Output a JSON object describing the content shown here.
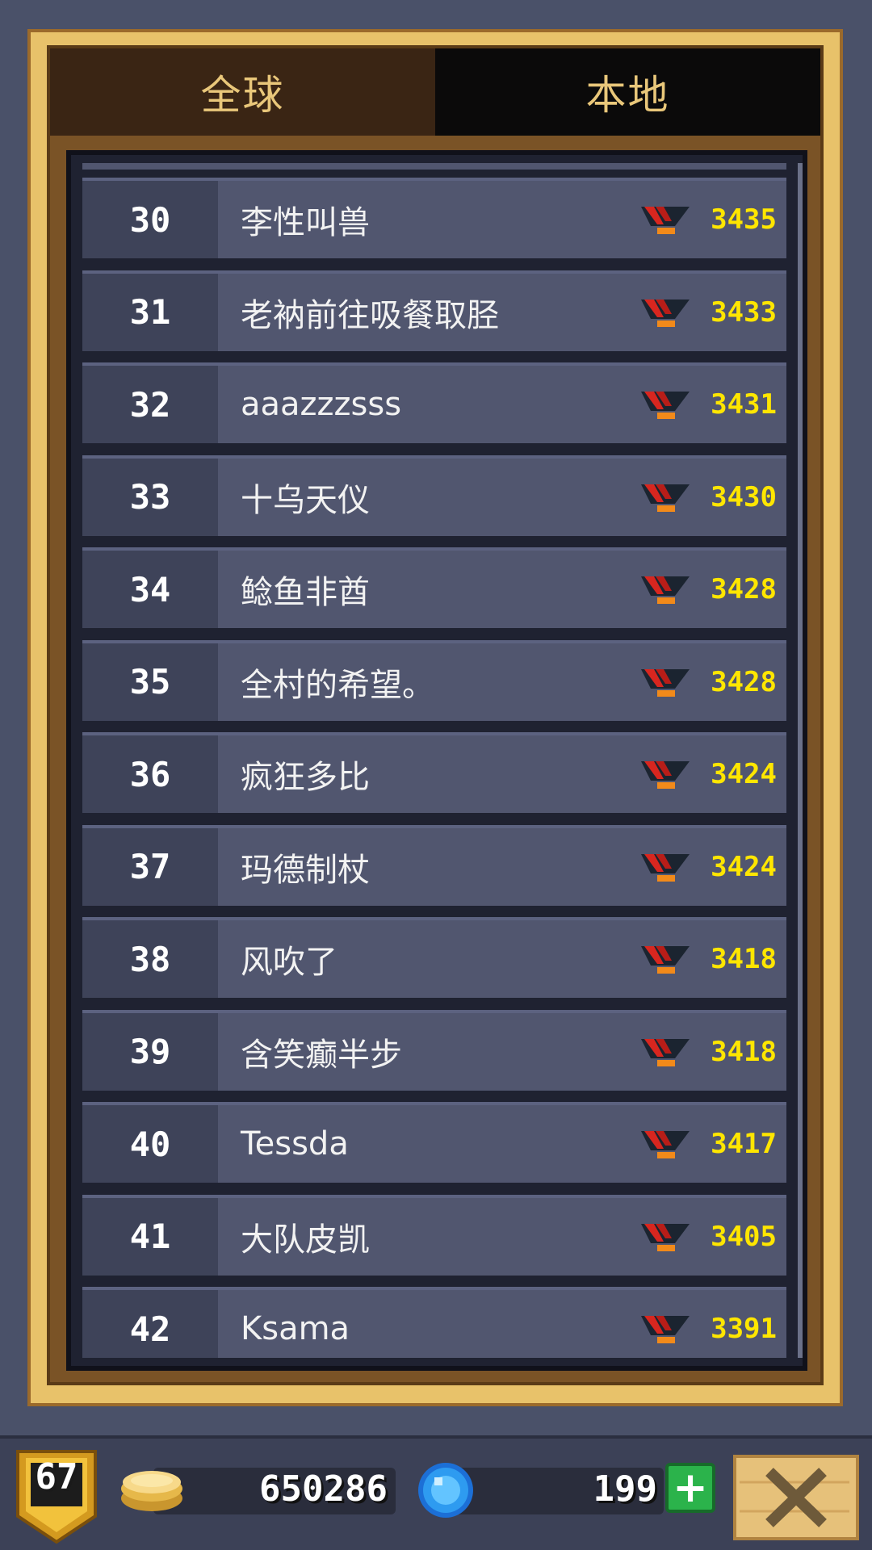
{
  "tabs": [
    {
      "label": "全球",
      "active": true
    },
    {
      "label": "本地",
      "active": false
    }
  ],
  "leaderboard": [
    {
      "rank": "30",
      "name": "李性叫兽",
      "score": "3435"
    },
    {
      "rank": "31",
      "name": "老衲前往吸餐取胫",
      "score": "3433"
    },
    {
      "rank": "32",
      "name": "aaazzzsss",
      "score": "3431"
    },
    {
      "rank": "33",
      "name": "十乌天仪",
      "score": "3430"
    },
    {
      "rank": "34",
      "name": "鲶鱼非酋",
      "score": "3428"
    },
    {
      "rank": "35",
      "name": "全村的希望。",
      "score": "3428"
    },
    {
      "rank": "36",
      "name": "疯狂多比",
      "score": "3424"
    },
    {
      "rank": "37",
      "name": "玛德制杖",
      "score": "3424"
    },
    {
      "rank": "38",
      "name": "风吹了",
      "score": "3418"
    },
    {
      "rank": "39",
      "name": "含笑癫半步",
      "score": "3418"
    },
    {
      "rank": "40",
      "name": "Tessda",
      "score": "3417"
    },
    {
      "rank": "41",
      "name": "大队皮凯",
      "score": "3405"
    },
    {
      "rank": "42",
      "name": "Ksama",
      "score": "3391"
    }
  ],
  "rank_icon": "red-wing-rank-icon",
  "status_bar": {
    "level": "67",
    "coins": "650286",
    "gems": "199",
    "plus_label": "+"
  },
  "colors": {
    "score": "#ffe600",
    "tab_text": "#e9c77a",
    "row": "#51566f",
    "rank_cell": "#3e4359"
  }
}
